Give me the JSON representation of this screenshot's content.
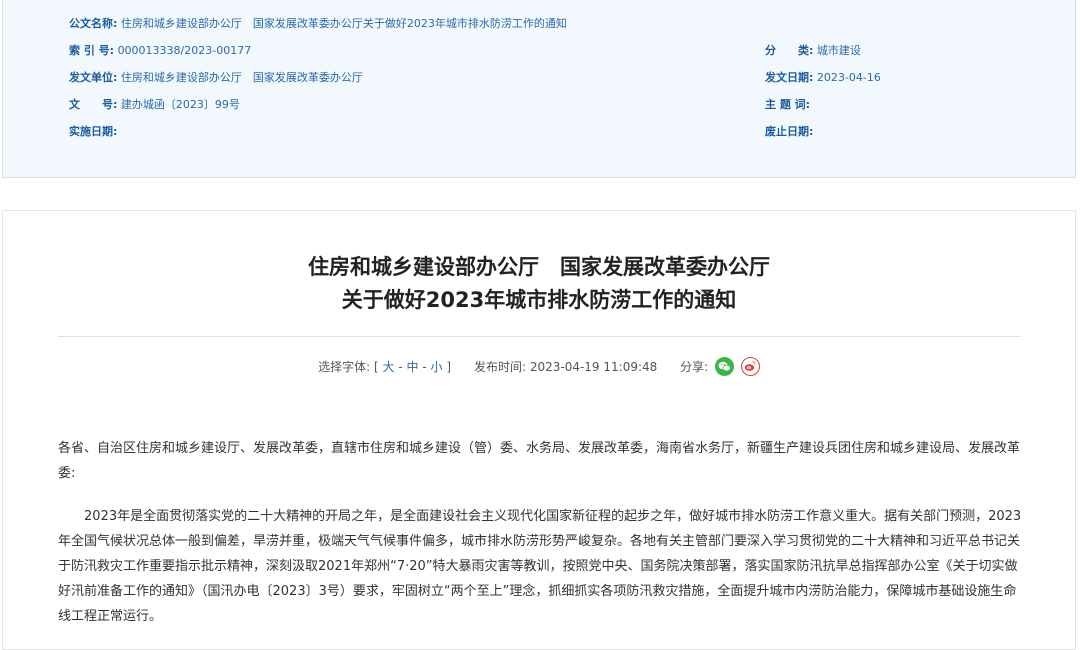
{
  "meta": {
    "doc_name_label": "公文名称:",
    "doc_name_value": "住房和城乡建设部办公厅　国家发展改革委办公厅关于做好2023年城市排水防涝工作的通知",
    "index_label": "索 引 号:",
    "index_value": "000013338/2023-00177",
    "category_label": "分　　类:",
    "category_value": "城市建设",
    "issuer_label": "发文单位:",
    "issuer_value": "住房和城乡建设部办公厅　国家发展改革委办公厅",
    "issue_date_label": "发文日期:",
    "issue_date_value": "2023-04-16",
    "doc_no_label": "文　　号:",
    "doc_no_value": "建办城函〔2023〕99号",
    "subject_label": "主 题 词:",
    "subject_value": "",
    "effective_label": "实施日期:",
    "effective_value": "",
    "expire_label": "废止日期:",
    "expire_value": ""
  },
  "article": {
    "title_line1": "住房和城乡建设部办公厅　国家发展改革委办公厅",
    "title_line2": "关于做好2023年城市排水防涝工作的通知",
    "font_select_label": "选择字体:",
    "bracket_open": "[",
    "font_large": "大",
    "font_medium": "中",
    "font_small": "小",
    "sep": "-",
    "bracket_close": "]",
    "publish_label": "发布时间:",
    "publish_time": "2023-04-19 11:09:48",
    "share_label": "分享:",
    "recipients": "各省、自治区住房和城乡建设厅、发展改革委，直辖市住房和城乡建设（管）委、水务局、发展改革委，海南省水务厅，新疆生产建设兵团住房和城乡建设局、发展改革委:",
    "paragraph1": "2023年是全面贯彻落实党的二十大精神的开局之年，是全面建设社会主义现代化国家新征程的起步之年，做好城市排水防涝工作意义重大。据有关部门预测，2023年全国气候状况总体一般到偏差，旱涝并重，极端天气气候事件偏多，城市排水防涝形势严峻复杂。各地有关主管部门要深入学习贯彻党的二十大精神和习近平总书记关于防汛救灾工作重要指示批示精神，深刻汲取2021年郑州“7·20”特大暴雨灾害等教训，按照党中央、国务院决策部署，落实国家防汛抗旱总指挥部办公室《关于切实做好汛前准备工作的通知》（国汛办电〔2023〕3号）要求，牢固树立“两个至上”理念，抓细抓实各项防汛救灾措施，全面提升城市内涝防治能力，保障城市基础设施生命线工程正常运行。"
  },
  "icons": {
    "wechat": "wechat-icon",
    "weibo": "weibo-icon"
  },
  "colors": {
    "meta_label": "#1b5b9e",
    "meta_value": "#2a6aac",
    "link": "#2b66b0",
    "wechat": "#3bb44a",
    "weibo": "#e23a3a"
  }
}
